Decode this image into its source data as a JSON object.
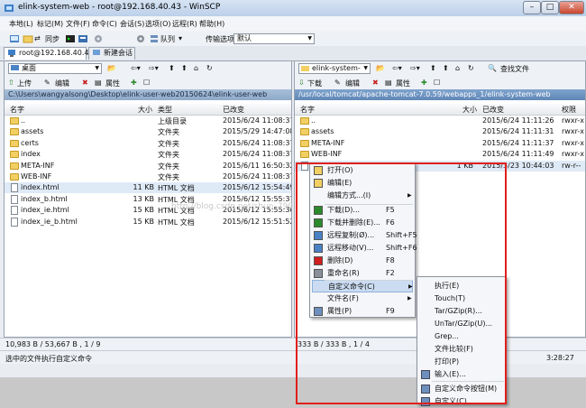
{
  "window": {
    "title": "elink-system-web - root@192.168.40.43 - WinSCP"
  },
  "menu": [
    "本地(L)",
    "标记(M)",
    "文件(F)",
    "命令(C)",
    "会话(S)",
    "选项(O)",
    "远程(R)",
    "帮助(H)"
  ],
  "toolbar": {
    "sync": "同步",
    "queue": "队列",
    "transfer_label": "传输选项",
    "transfer_value": "默认"
  },
  "tabs": [
    "root@192.168.40.43",
    "新建会话"
  ],
  "left": {
    "location": "桌面",
    "buttons": {
      "upload": "上传",
      "edit": "编辑",
      "props": "属性"
    },
    "path": "C:\\Users\\wangyalsong\\Desktop\\elink-user-web20150624\\elink-user-web",
    "columns": [
      "名字",
      "大小",
      "类型",
      "已改变"
    ],
    "rows": [
      {
        "name": "..",
        "size": "",
        "type": "上级目录",
        "date": "2015/6/24  11:08:37",
        "kind": "up"
      },
      {
        "name": "assets",
        "size": "",
        "type": "文件夹",
        "date": "2015/5/29  14:47:08",
        "kind": "folder"
      },
      {
        "name": "certs",
        "size": "",
        "type": "文件夹",
        "date": "2015/6/24  11:08:37",
        "kind": "folder"
      },
      {
        "name": "index",
        "size": "",
        "type": "文件夹",
        "date": "2015/6/24  11:08:37",
        "kind": "folder"
      },
      {
        "name": "META-INF",
        "size": "",
        "type": "文件夹",
        "date": "2015/6/11  16:50:32",
        "kind": "folder"
      },
      {
        "name": "WEB-INF",
        "size": "",
        "type": "文件夹",
        "date": "2015/6/24  11:08:37",
        "kind": "folder"
      },
      {
        "name": "index.html",
        "size": "11 KB",
        "type": "HTML 文档",
        "date": "2015/6/12  15:54:49",
        "kind": "file"
      },
      {
        "name": "index_b.html",
        "size": "13 KB",
        "type": "HTML 文档",
        "date": "2015/6/12  15:55:37",
        "kind": "file"
      },
      {
        "name": "index_ie.html",
        "size": "15 KB",
        "type": "HTML 文档",
        "date": "2015/6/12  15:55:30",
        "kind": "file"
      },
      {
        "name": "index_ie_b.html",
        "size": "15 KB",
        "type": "HTML 文档",
        "date": "2015/6/12  15:51:52",
        "kind": "file"
      }
    ],
    "summary": "10,983 B / 53,667 B , 1 / 9"
  },
  "right": {
    "location": "elink-system-",
    "buttons": {
      "download": "下载",
      "edit": "编辑",
      "props": "属性"
    },
    "find": "查找文件",
    "path": "/usr/local/tomcat/apache-tomcat-7.0.59/webapps_1/elink-system-web",
    "columns": [
      "名字",
      "大小",
      "已改变",
      "权限"
    ],
    "rows": [
      {
        "name": "..",
        "size": "",
        "date": "2015/6/24  11:11:26",
        "perm": "rwxr-x",
        "kind": "up"
      },
      {
        "name": "assets",
        "size": "",
        "date": "2015/6/24  11:11:31",
        "perm": "rwxr-x",
        "kind": "folder"
      },
      {
        "name": "META-INF",
        "size": "",
        "date": "2015/6/24  11:11:37",
        "perm": "rwxr-x",
        "kind": "folder"
      },
      {
        "name": "WEB-INF",
        "size": "",
        "date": "2015/6/24  11:11:49",
        "perm": "rwxr-x",
        "kind": "folder"
      },
      {
        "name": "",
        "size": "1 KB",
        "date": "2015/3/23  10:44:03",
        "perm": "rw-r--",
        "kind": "file"
      }
    ],
    "summary": "333 B / 333 B , 1 / 4"
  },
  "status": {
    "message": "选中的文件执行自定义命令",
    "time": "3:28:27"
  },
  "watermark": "http://blog.csdn.net/shun_790",
  "context_menu": [
    {
      "label": "打开(O)",
      "shortcut": "",
      "icon": "open-icon"
    },
    {
      "label": "编辑(E)",
      "shortcut": "",
      "icon": "edit-icon"
    },
    {
      "label": "编辑方式...(I)",
      "shortcut": "",
      "icon": "",
      "submenu": true
    },
    {
      "label": "下载(D)...",
      "shortcut": "F5",
      "icon": "download-icon"
    },
    {
      "label": "下载并删除(E)...",
      "shortcut": "F6",
      "icon": "download-delete-icon"
    },
    {
      "label": "远程复制(Ø)...",
      "shortcut": "Shift+F5",
      "icon": "remote-copy-icon"
    },
    {
      "label": "远程移动(V)...",
      "shortcut": "Shift+F6",
      "icon": "remote-move-icon"
    },
    {
      "label": "删除(D)",
      "shortcut": "F8",
      "icon": "delete-icon"
    },
    {
      "label": "重命名(R)",
      "shortcut": "F2",
      "icon": "rename-icon"
    },
    {
      "label": "自定义命令(C)",
      "shortcut": "",
      "icon": "",
      "submenu": true
    },
    {
      "label": "文件名(F)",
      "shortcut": "",
      "icon": "",
      "submenu": true
    },
    {
      "label": "属性(P)",
      "shortcut": "F9",
      "icon": "properties-icon"
    }
  ],
  "submenu": [
    "执行(E)",
    "Touch(T)",
    "Tar/GZip(R)...",
    "UnTar/GZip(U)...",
    "Grep...",
    "文件比较(F)",
    "打印(P)",
    "输入(E)...",
    "自定义命令按钮(M)",
    "自定义(C)..."
  ],
  "colors": {
    "highlight": "#cbdcf2",
    "annotation": "#e0201c",
    "path_active": "#5f86b6"
  }
}
